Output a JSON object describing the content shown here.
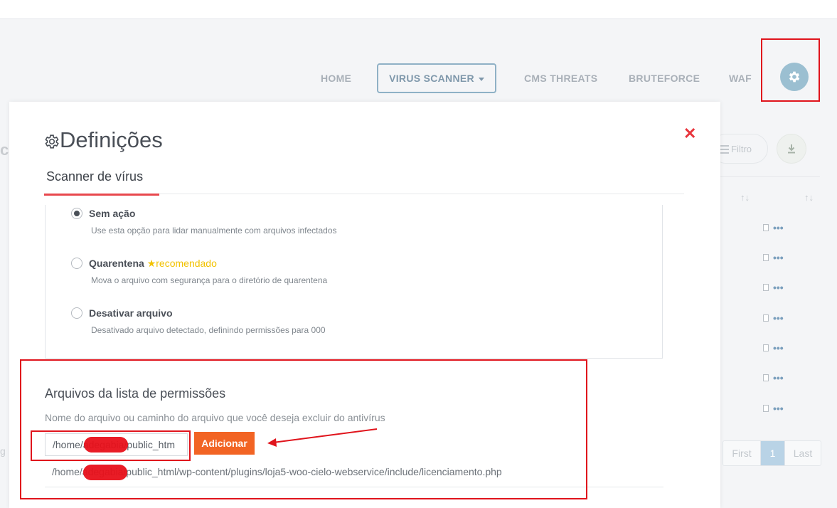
{
  "nav": {
    "items": [
      "HOME",
      "VIRUS SCANNER",
      "CMS THREATS",
      "BRUTEFORCE",
      "WAF"
    ],
    "settings_icon": "gear-icon"
  },
  "background": {
    "filter_label": "Filtro",
    "download_icon": "download-icon",
    "row_file_icon": "file-icon",
    "row_more_icon": "more-dots-icon",
    "pagination": {
      "first": "First",
      "current": "1",
      "last": "Last"
    }
  },
  "modal": {
    "title": "Definições",
    "title_icon": "gear-outline-icon",
    "close_icon": "close-icon",
    "tab": "Scanner de vírus",
    "options": [
      {
        "label": "Sem ação",
        "description": "Use esta opção para lidar manualmente com arquivos infectados",
        "selected": true
      },
      {
        "label": "Quarentena",
        "badge": "recomendado",
        "badge_icon": "star-icon",
        "description": "Mova o arquivo com segurança para o diretório de quarentena",
        "selected": false
      },
      {
        "label": "Desativar arquivo",
        "description": "Desativado arquivo detectado, definindo permissões para 000",
        "selected": false
      }
    ],
    "allowlist": {
      "title": "Arquivos da lista de permissões",
      "description": "Nome do arquivo ou caminho do arquivo que você deseja excluir do antivírus",
      "input_value": "/home/adegabia/public_htm",
      "add_button": "Adicionar",
      "entries": [
        "/home/adegabia/public_html/wp-content/plugins/loja5-woo-cielo-webservice/include/licenciamento.php"
      ]
    }
  },
  "colors": {
    "accent_red": "#e8474d",
    "button_orange": "#f26424",
    "recommended_yellow": "#f2c200",
    "highlight_box": "#e0141c"
  }
}
